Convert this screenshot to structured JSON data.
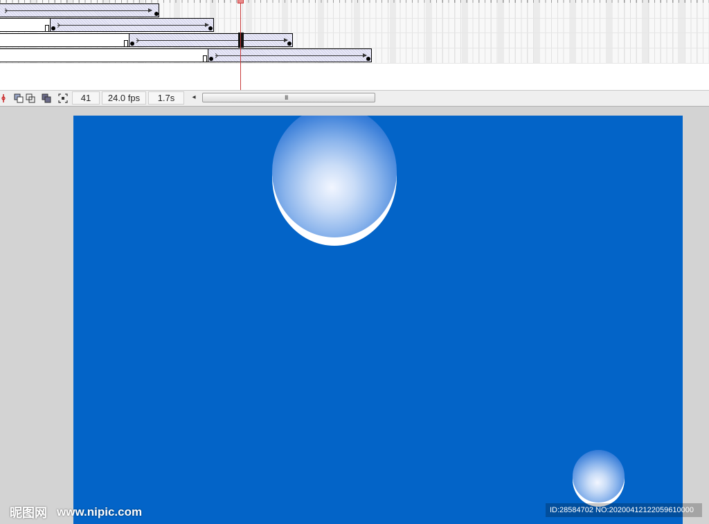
{
  "timeline": {
    "current_frame": "41",
    "frame_rate": "24.0 fps",
    "elapsed_time": "1.7s",
    "scroll_grip": "III",
    "scroll_left_arrow": "◂"
  },
  "status_icons": [
    "center-frame-icon",
    "onion-skin-icon",
    "onion-skin-outlines-icon",
    "edit-multiple-frames-icon",
    "modify-onion-markers-icon"
  ],
  "stage": {
    "background_color": "#0364c8"
  },
  "watermark": {
    "logo_text": "昵图网",
    "url": "www.nipic.com",
    "id_text": "ID:28584702 NO:20200412122059610000"
  }
}
